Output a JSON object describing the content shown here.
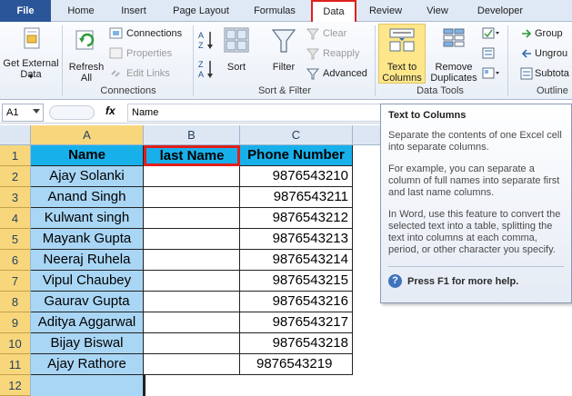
{
  "tabs": [
    {
      "label": "File"
    },
    {
      "label": "Home"
    },
    {
      "label": "Insert"
    },
    {
      "label": "Page Layout"
    },
    {
      "label": "Formulas"
    },
    {
      "label": "Data"
    },
    {
      "label": "Review"
    },
    {
      "label": "View"
    },
    {
      "label": "Developer"
    }
  ],
  "ribbon": {
    "get_external_data": "Get External Data",
    "get_external_data_arrow": "▾",
    "refresh_all": "Refresh All",
    "connections": "Connections",
    "properties": "Properties",
    "edit_links": "Edit Links",
    "group_connections": "Connections",
    "sort": "Sort",
    "filter": "Filter",
    "clear": "Clear",
    "reapply": "Reapply",
    "advanced": "Advanced",
    "group_sort_filter": "Sort & Filter",
    "text_to_columns": "Text to Columns",
    "remove_duplicates": "Remove Duplicates",
    "group_data_tools": "Data Tools",
    "group_btn": "Group",
    "ungroup_btn": "Ungrou",
    "subtotal_btn": "Subtota",
    "group_outline": "Outline"
  },
  "formula_bar": {
    "cell_ref": "A1",
    "fx": "fx",
    "value": "Name"
  },
  "columns": [
    "A",
    "B",
    "C"
  ],
  "rows": [
    {
      "num": "1",
      "a": "Name",
      "b": "last Name",
      "c": "Phone Number"
    },
    {
      "num": "2",
      "a": "Ajay Solanki",
      "b": "",
      "c": "9876543210"
    },
    {
      "num": "3",
      "a": "Anand Singh",
      "b": "",
      "c": "9876543211"
    },
    {
      "num": "4",
      "a": "Kulwant singh",
      "b": "",
      "c": "9876543212"
    },
    {
      "num": "5",
      "a": "Mayank Gupta",
      "b": "",
      "c": "9876543213"
    },
    {
      "num": "6",
      "a": "Neeraj Ruhela",
      "b": "",
      "c": "9876543214"
    },
    {
      "num": "7",
      "a": "Vipul Chaubey",
      "b": "",
      "c": "9876543215"
    },
    {
      "num": "8",
      "a": "Gaurav Gupta",
      "b": "",
      "c": "9876543216"
    },
    {
      "num": "9",
      "a": "Aditya Aggarwal",
      "b": "",
      "c": "9876543217"
    },
    {
      "num": "10",
      "a": "Bijay Biswal",
      "b": "",
      "c": "9876543218"
    },
    {
      "num": "11",
      "a": "Ajay Rathore",
      "b": "",
      "c": "9876543219"
    },
    {
      "num": "12",
      "a": "",
      "b": "",
      "c": ""
    }
  ],
  "tooltip": {
    "title": "Text to Columns",
    "p1": "Separate the contents of one Excel cell into separate columns.",
    "p2": "For example, you can separate a column of full names into separate first and last name columns.",
    "p3": "In Word, use this feature to convert the selected text into a table, splitting the text into columns at each comma, period, or other character you specify.",
    "help": "Press F1 for more help.",
    "help_icon": "?"
  },
  "colors": {
    "name_column_fill": "#a9d6f5",
    "header_fill": "#18b0ea",
    "highlight_border": "#e0201b",
    "selected_header": "#f8d77c"
  }
}
